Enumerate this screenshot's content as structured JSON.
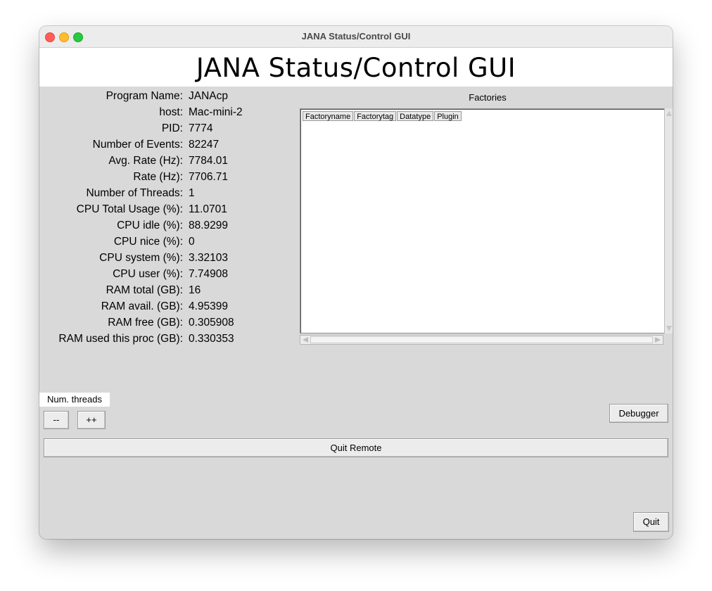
{
  "window": {
    "title": "JANA Status/Control GUI",
    "traffic_light_colors": {
      "close": "#fe5f57",
      "minimize": "#febc2e",
      "maximize": "#28c840"
    }
  },
  "banner": {
    "title": "JANA Status/Control GUI"
  },
  "info": [
    {
      "label": "Program Name:",
      "value": "JANAcp"
    },
    {
      "label": "host:",
      "value": "Mac-mini-2"
    },
    {
      "label": "PID:",
      "value": "7774"
    },
    {
      "label": "Number of Events:",
      "value": "82247"
    },
    {
      "label": "Avg. Rate (Hz):",
      "value": "7784.01"
    },
    {
      "label": "Rate (Hz):",
      "value": "7706.71"
    },
    {
      "label": "Number of Threads:",
      "value": "1"
    },
    {
      "label": "CPU Total Usage (%):",
      "value": "11.0701"
    },
    {
      "label": "CPU idle (%):",
      "value": "88.9299"
    },
    {
      "label": "CPU nice (%):",
      "value": "0"
    },
    {
      "label": "CPU system (%):",
      "value": "3.32103"
    },
    {
      "label": "CPU user (%):",
      "value": "7.74908"
    },
    {
      "label": "RAM total (GB):",
      "value": "16"
    },
    {
      "label": "RAM avail. (GB):",
      "value": "4.95399"
    },
    {
      "label": "RAM free (GB):",
      "value": "0.305908"
    },
    {
      "label": "RAM used this proc (GB):",
      "value": "0.330353"
    }
  ],
  "factories": {
    "title": "Factories",
    "columns": [
      "Factoryname",
      "Factorytag",
      "Datatype",
      "Plugin"
    ],
    "rows": []
  },
  "threads": {
    "label": "Num. threads",
    "decrement_label": "--",
    "increment_label": "++"
  },
  "buttons": {
    "debugger": "Debugger",
    "quit_remote": "Quit Remote",
    "quit": "Quit"
  }
}
